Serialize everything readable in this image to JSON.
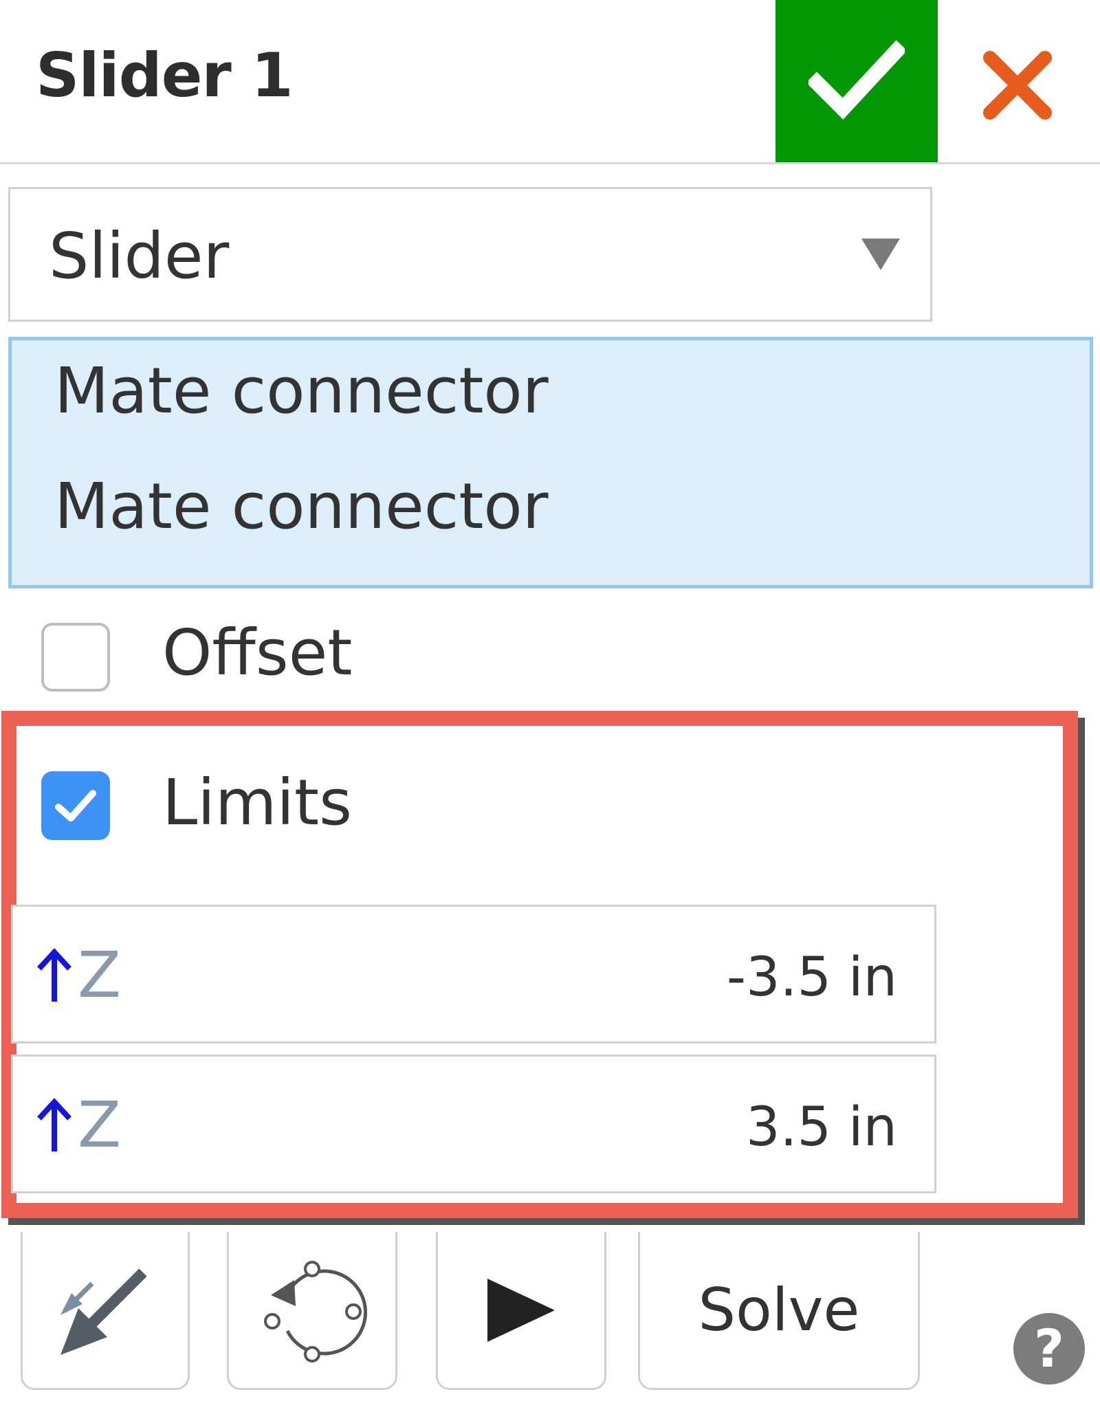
{
  "dialog": {
    "title": "Slider 1",
    "accept_icon": "check-icon",
    "cancel_icon": "close-icon",
    "accept_color": "#039803",
    "cancel_color": "#e65c1c"
  },
  "mate_type": {
    "selected": "Slider",
    "arrow_icon": "chevron-down-icon"
  },
  "selections": {
    "items": [
      "Mate connector",
      "Mate connector"
    ],
    "highlight_color": "#dbeef9",
    "border_color": "#8ec9ef"
  },
  "options": {
    "offset": {
      "label": "Offset",
      "checked": false
    },
    "limits": {
      "label": "Limits",
      "checked": true
    }
  },
  "limits": {
    "highlight_color": "#ec5f53",
    "fields": [
      {
        "axis_icon": "arrow-up-icon",
        "axis": "Z",
        "value": "-3.5 in"
      },
      {
        "axis_icon": "arrow-up-icon",
        "axis": "Z",
        "value": "3.5 in"
      }
    ]
  },
  "toolbar": {
    "flip_icon": "flip-primary-axis-icon",
    "reorient_icon": "reorient-secondary-axis-icon",
    "animate_icon": "play-icon",
    "solve_label": "Solve",
    "help_icon": "help-icon",
    "help_glyph": "?"
  }
}
